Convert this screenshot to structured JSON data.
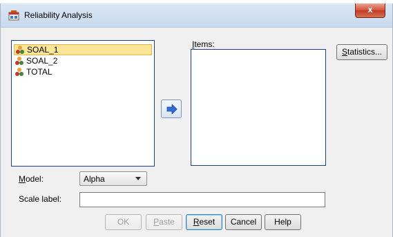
{
  "window": {
    "title": "Reliability Analysis",
    "close_label": "x"
  },
  "source_list": {
    "items": [
      {
        "label": "SOAL_1",
        "selected": true,
        "icon": "nominal-variable-icon"
      },
      {
        "label": "SOAL_2",
        "selected": false,
        "icon": "nominal-variable-icon"
      },
      {
        "label": "TOTAL",
        "selected": false,
        "icon": "nominal-variable-icon"
      }
    ]
  },
  "items_list": {
    "label": "Items:",
    "items": []
  },
  "buttons": {
    "statistics": "Statistics...",
    "ok": "OK",
    "paste": "Paste",
    "reset": "Reset",
    "cancel": "Cancel",
    "help": "Help"
  },
  "model": {
    "label": "Model:",
    "value": "Alpha"
  },
  "scale": {
    "label": "Scale label:",
    "value": ""
  },
  "colors": {
    "selection_bg": "#fbe697",
    "list_border": "#1c3c8e",
    "arrow_blue": "#2e6dd6"
  }
}
